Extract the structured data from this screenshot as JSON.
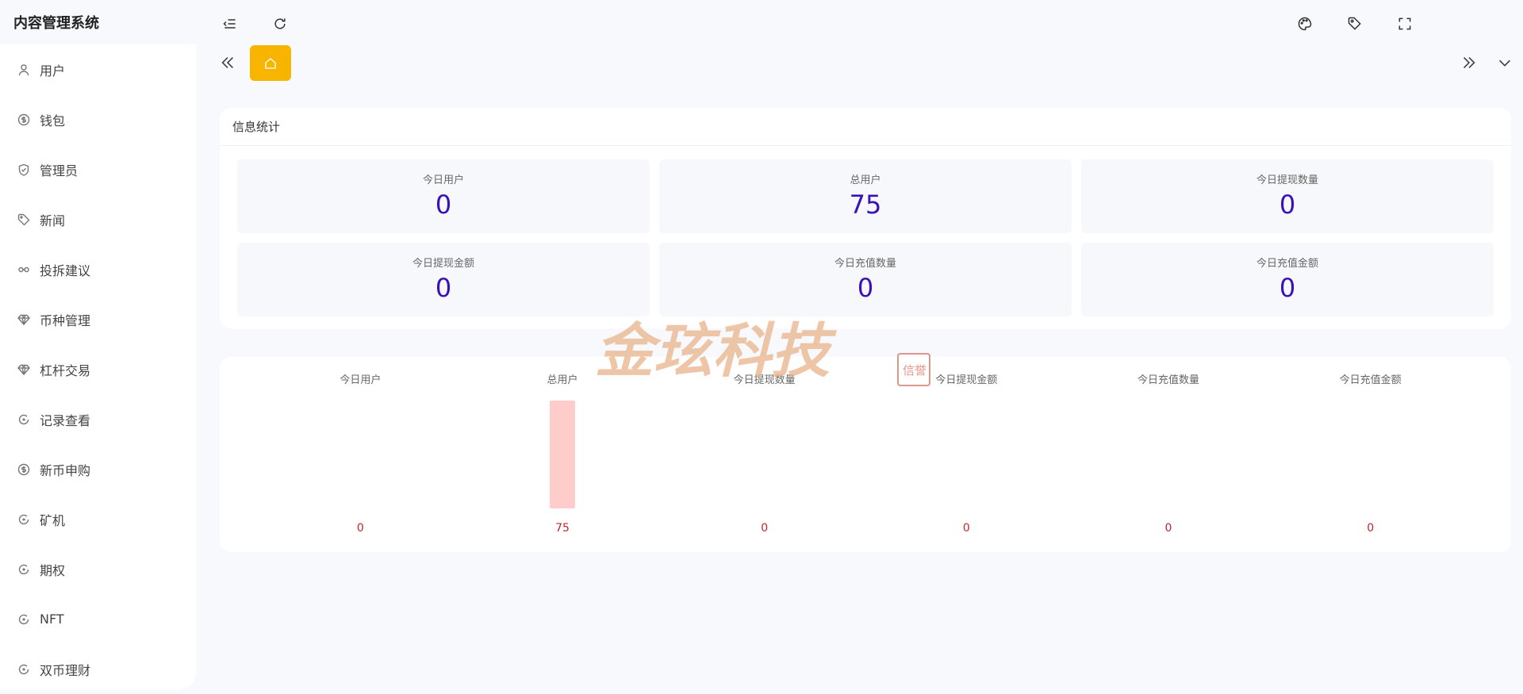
{
  "app": {
    "title": "内容管理系统"
  },
  "sidebar": {
    "items": [
      {
        "label": "用户",
        "icon": "user-icon"
      },
      {
        "label": "钱包",
        "icon": "dollar-icon"
      },
      {
        "label": "管理员",
        "icon": "shield-icon"
      },
      {
        "label": "新闻",
        "icon": "tag-icon"
      },
      {
        "label": "投拆建议",
        "icon": "link-icon"
      },
      {
        "label": "币种管理",
        "icon": "diamond-icon"
      },
      {
        "label": "杠杆交易",
        "icon": "diamond-icon"
      },
      {
        "label": "记录查看",
        "icon": "circle-arrow-icon"
      },
      {
        "label": "新币申购",
        "icon": "dollar-icon"
      },
      {
        "label": "矿机",
        "icon": "circle-arrow-icon"
      },
      {
        "label": "期权",
        "icon": "circle-arrow-icon"
      },
      {
        "label": "NFT",
        "icon": "circle-arrow-icon"
      },
      {
        "label": "双币理财",
        "icon": "circle-arrow-icon"
      }
    ]
  },
  "toolbar": {
    "left_icons": [
      "menu-fold-icon",
      "refresh-icon"
    ],
    "right_icons": [
      "palette-icon",
      "tag-icon",
      "fullscreen-icon"
    ]
  },
  "tabs": {
    "home_icon": "home-icon",
    "accent_color": "#f7b500"
  },
  "stats": {
    "title": "信息统计",
    "cards": [
      {
        "label": "今日用户",
        "value": "0"
      },
      {
        "label": "总用户",
        "value": "75"
      },
      {
        "label": "今日提现数量",
        "value": "0"
      },
      {
        "label": "今日提现金额",
        "value": "0"
      },
      {
        "label": "今日充值数量",
        "value": "0"
      },
      {
        "label": "今日充值金额",
        "value": "0"
      }
    ],
    "value_color": "#3a10b8"
  },
  "chart_data": {
    "type": "bar",
    "categories": [
      "今日用户",
      "总用户",
      "今日提现数量",
      "今日提现金额",
      "今日充值数量",
      "今日充值金额"
    ],
    "values": [
      0,
      75,
      0,
      0,
      0,
      0
    ],
    "value_labels": [
      "0",
      "75",
      "0",
      "0",
      "0",
      "0"
    ],
    "bar_color": "#ffcccc",
    "label_color": "#c1272d",
    "ylim": [
      0,
      75
    ]
  },
  "watermark": {
    "text": "金玹科技",
    "seal_text": "信誉"
  }
}
